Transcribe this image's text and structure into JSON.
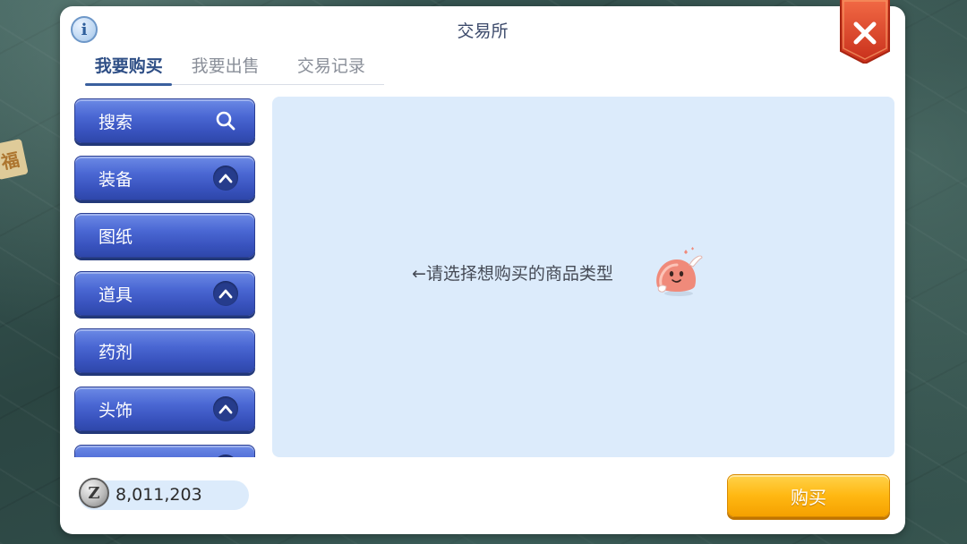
{
  "window": {
    "title": "交易所"
  },
  "tabs": [
    {
      "label": "我要购买",
      "active": true
    },
    {
      "label": "我要出售",
      "active": false
    },
    {
      "label": "交易记录",
      "active": false
    }
  ],
  "categories": [
    {
      "label": "搜索",
      "icon": "search-icon"
    },
    {
      "label": "装备",
      "icon": "chevron-up-icon"
    },
    {
      "label": "图纸",
      "icon": ""
    },
    {
      "label": "道具",
      "icon": "chevron-up-icon"
    },
    {
      "label": "药剂",
      "icon": ""
    },
    {
      "label": "头饰",
      "icon": "chevron-up-icon"
    },
    {
      "label": "",
      "icon": "chevron-up-icon"
    }
  ],
  "content": {
    "hint": "←请选择想购买的商品类型"
  },
  "wallet": {
    "zeny_amount": "8,011,203"
  },
  "actions": {
    "buy_label": "购买"
  },
  "colors": {
    "category_button": "#4a67d3",
    "buy_button": "#ffb812",
    "close_button": "#e0452b",
    "content_bg": "#dcebfb"
  }
}
